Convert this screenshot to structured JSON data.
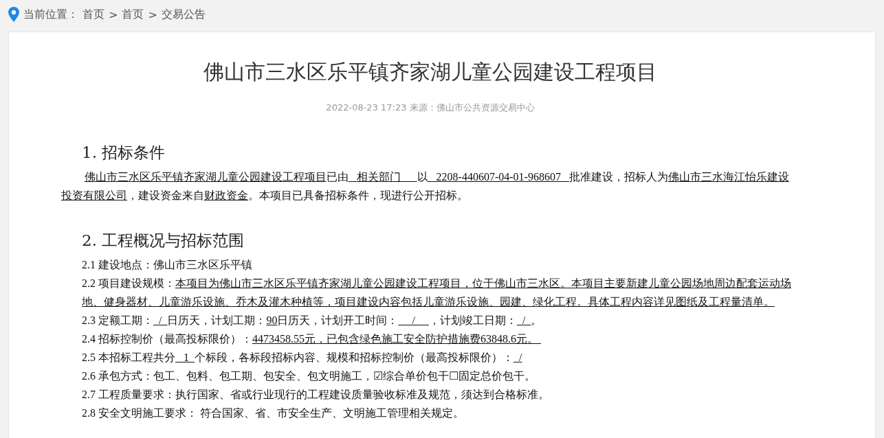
{
  "breadcrumb": {
    "label": "当前位置：",
    "items": [
      {
        "text": "首页",
        "separator": ">"
      },
      {
        "text": "首页",
        "separator": ">"
      },
      {
        "text": "交易公告"
      }
    ]
  },
  "article": {
    "title": "佛山市三水区乐平镇齐家湖儿童公园建设工程项目",
    "meta": "2022-08-23 17:23 来源：佛山市公共资源交易中心",
    "sections": [
      {
        "heading": "1. 招标条件",
        "paragraphs": [
          {
            "kind": "indent",
            "segments": [
              {
                "text": "佛山市三水区乐平镇齐家湖儿童公园建设工程项目",
                "underline": true
              },
              {
                "text": "已由",
                "underline": false
              },
              {
                "text": "   相关部门      ",
                "underline": true
              },
              {
                "text": "以",
                "underline": false
              },
              {
                "text": "   2208-440607-04-01-968607   ",
                "underline": true
              },
              {
                "text": "批准建设，招标人为",
                "underline": false
              },
              {
                "text": "佛山市三水海江怡乐建设投资有限公司",
                "underline": true
              },
              {
                "text": "，建设资金来自",
                "underline": false
              },
              {
                "text": "财政资金",
                "underline": true
              },
              {
                "text": "。本项目已具备招标条件，现进行公开招标。",
                "underline": false
              }
            ]
          }
        ]
      },
      {
        "heading": "2. 工程概况与招标范围",
        "paragraphs": [
          {
            "kind": "item",
            "segments": [
              {
                "text": "2.1 建设地点：佛山市三水区乐平镇",
                "underline": false
              }
            ]
          },
          {
            "kind": "item",
            "segments": [
              {
                "text": "2.2 项目建设规模：",
                "underline": false
              },
              {
                "text": "本项目为佛山市三水区乐平镇齐家湖儿童公园建设工程项目，位于佛山市三水区。本项目主要新建儿童公园场地周边配套运动场地、健身器材、儿童游乐设施、乔木及灌木种植等，项目建设内容包括儿童游乐设施、园建、绿化工程。具体工程内容详见图纸及工程量清单。",
                "underline": true
              }
            ]
          },
          {
            "kind": "item",
            "segments": [
              {
                "text": "2.3 定额工期：",
                "underline": false
              },
              {
                "text": "  /  ",
                "underline": true
              },
              {
                "text": "日历天，计划工期：",
                "underline": false
              },
              {
                "text": "90",
                "underline": true
              },
              {
                "text": "日历天，计划开工时间：",
                "underline": false
              },
              {
                "text": "     /     ",
                "underline": true
              },
              {
                "text": "，计划竣工日期：",
                "underline": false
              },
              {
                "text": "  /  ",
                "underline": true
              },
              {
                "text": "。",
                "underline": false
              }
            ]
          },
          {
            "kind": "item",
            "segments": [
              {
                "text": "2.4 招标控制价（最高投标限价）：",
                "underline": false
              },
              {
                "text": "4473458.55元，已包含绿色施工安全防护措施费63848.6元。 ",
                "underline": true
              }
            ]
          },
          {
            "kind": "item",
            "segments": [
              {
                "text": "2.5 本招标工程共分",
                "underline": false
              },
              {
                "text": "   1  ",
                "underline": true
              },
              {
                "text": "个标段，各标段招标内容、规模和招标控制价（最高投标限价）：",
                "underline": false
              },
              {
                "text": "  /",
                "underline": true
              }
            ]
          },
          {
            "kind": "item",
            "segments": [
              {
                "text": "2.6 承包方式：包工、包料、包工期、包安全、包文明施工，☑综合单价包干☐固定总价包干。",
                "underline": false
              }
            ]
          },
          {
            "kind": "item",
            "segments": [
              {
                "text": "2.7 工程质量要求：执行国家、省或行业现行的工程建设质量验收标准及规范，须达到合格标准。",
                "underline": false
              }
            ]
          },
          {
            "kind": "item",
            "segments": [
              {
                "text": "2.8 安全文明施工要求： 符合国家、省、市安全生产、文明施工管理相关规定。",
                "underline": false
              }
            ]
          }
        ]
      }
    ]
  }
}
